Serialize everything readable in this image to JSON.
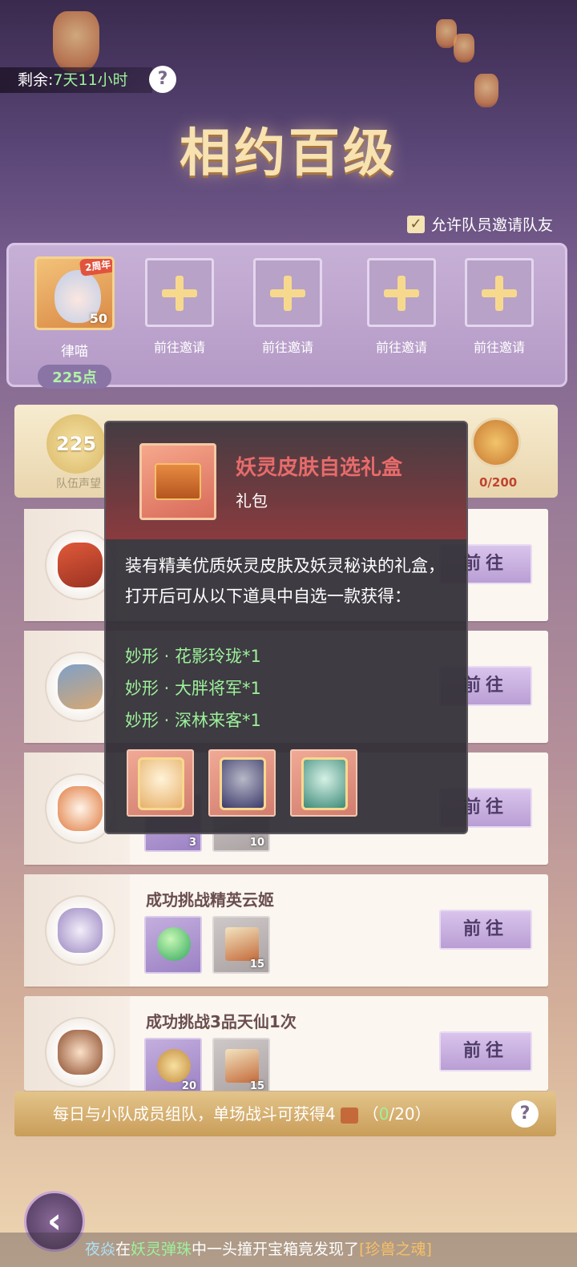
{
  "timer": {
    "label": "剩余:",
    "value": "7天11小时"
  },
  "help_glyph": "?",
  "title": "相约百级",
  "allow_invite": {
    "checked": true,
    "check_glyph": "✓",
    "label": "允许队员邀请队友"
  },
  "leader": {
    "name": "律喵",
    "level": "50",
    "badge": "2周年",
    "points": "225点"
  },
  "invite_slots": [
    {
      "label": "前往邀请"
    },
    {
      "label": "前往邀请"
    },
    {
      "label": "前往邀请"
    },
    {
      "label": "前往邀请"
    }
  ],
  "reward_bar": {
    "prestige_value": "225",
    "prestige_label": "队伍声望",
    "gift_progress": "0/200"
  },
  "tasks": [
    {
      "title": "",
      "button": "前往",
      "items": []
    },
    {
      "title": "",
      "button": "前往",
      "items": []
    },
    {
      "title": "",
      "button": "前往",
      "items": [
        {
          "count": "3"
        },
        {
          "count": "10"
        }
      ]
    },
    {
      "title": "成功挑战精英云姬",
      "button": "前往",
      "items": [
        {
          "icon": "green-orb-icon",
          "count": ""
        },
        {
          "icon": "team-flag-icon",
          "count": "15"
        }
      ]
    },
    {
      "title": "成功挑战3品天仙1次",
      "button": "前往",
      "items": [
        {
          "icon": "team-token-icon",
          "count": "20"
        },
        {
          "icon": "team-flag-icon",
          "count": "15"
        }
      ]
    }
  ],
  "bottom_strip": {
    "text": "每日与小队成员组队，单场战斗可获得4",
    "progress_open": "（",
    "progress_current": "0",
    "progress_total": "/20",
    "progress_close": "）"
  },
  "back_glyph": "‹",
  "ticker": {
    "player": "夜焱",
    "in": "在",
    "game": "妖灵弹珠",
    "mid": "中一头撞开宝箱竟发现了",
    "item": "[珍兽之魂]"
  },
  "tooltip": {
    "name": "妖灵皮肤自选礼盒",
    "type": "礼包",
    "description": "装有精美优质妖灵皮肤及妖灵秘诀的礼盒，打开后可从以下道具中自选一款获得：",
    "options": [
      "妙形 · 花影玲珑*1",
      "妙形 · 大胖将军*1",
      "妙形 · 深林来客*1"
    ]
  },
  "colors": {
    "accent_green": "#9cf29a",
    "tooltip_title": "#e76b6b",
    "button_purple": "#b99ed4"
  }
}
